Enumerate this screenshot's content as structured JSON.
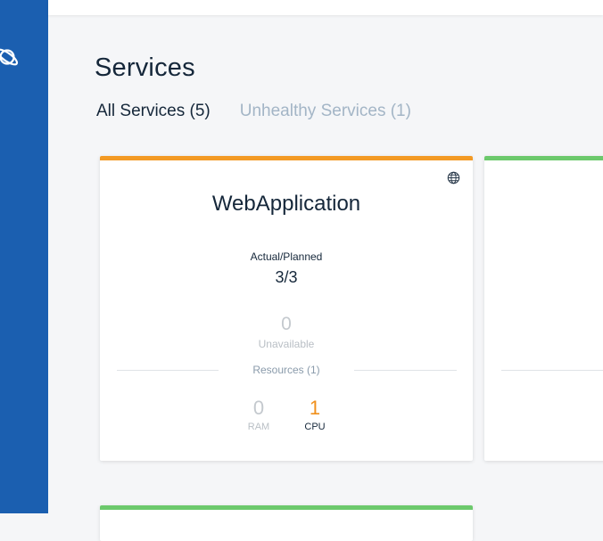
{
  "page": {
    "title": "Services"
  },
  "tabs": [
    {
      "label": "All Services (5)",
      "active": true
    },
    {
      "label": "Unhealthy Services (1)",
      "active": false
    }
  ],
  "colors": {
    "sidebar": "#1b5fb0",
    "warning_stripe": "#f39a24",
    "healthy_stripe": "#6cc96c",
    "cpu_highlight": "#f0901c"
  },
  "cards": [
    {
      "status": "warning",
      "icon": "globe-icon",
      "name": "WebApplication",
      "actual_planned_label": "Actual/Planned",
      "actual_planned_value": "3/3",
      "unavailable_count": "0",
      "unavailable_label": "Unavailable",
      "resources_label": "Resources (1)",
      "ram_value": "0",
      "ram_label": "RAM",
      "cpu_value": "1",
      "cpu_label": "CPU"
    },
    {
      "status": "healthy"
    },
    {
      "status": "healthy"
    }
  ]
}
